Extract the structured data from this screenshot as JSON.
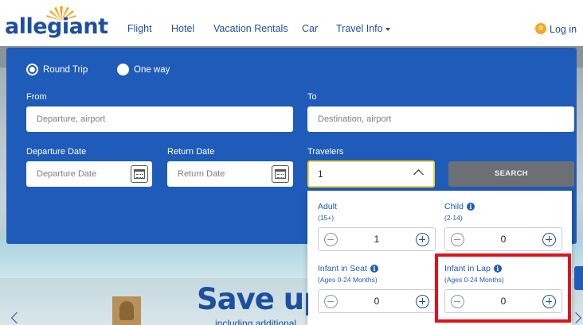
{
  "header": {
    "logo_text": "allegiant",
    "nav": [
      {
        "label": "Flight"
      },
      {
        "label": "Hotel"
      },
      {
        "label": "Vacation Rentals"
      },
      {
        "label": "Car"
      },
      {
        "label": "Travel Info"
      }
    ],
    "login_label": "Log in"
  },
  "search": {
    "trip_types": [
      {
        "label": "Round Trip",
        "selected": true
      },
      {
        "label": "One way",
        "selected": false
      }
    ],
    "from_label": "From",
    "from_placeholder": "Departure, airport",
    "to_label": "To",
    "to_placeholder": "Destination, airport",
    "departure_label": "Departure Date",
    "departure_placeholder": "Departure Date",
    "return_label": "Return Date",
    "return_placeholder": "Return Date",
    "travelers_label": "Travelers",
    "travelers_value": "1",
    "search_button": "SEARCH"
  },
  "travelers_panel": {
    "adult": {
      "label": "Adult",
      "sub": "(15+)",
      "value": "1"
    },
    "child": {
      "label": "Child",
      "sub": "(2-14)",
      "value": "0"
    },
    "infant_seat": {
      "label": "Infant in Seat",
      "sub": "(Ages 0-24 Months)",
      "value": "0"
    },
    "infant_lap": {
      "label": "Infant in Lap",
      "sub": "(Ages 0-24 Months)",
      "value": "0"
    }
  },
  "promo": {
    "title": "Save up",
    "subtitle": "including additional"
  },
  "colors": {
    "brand_blue": "#1f5bb8",
    "highlight_red": "#e3111b",
    "focus_yellow": "#f0d63b"
  }
}
